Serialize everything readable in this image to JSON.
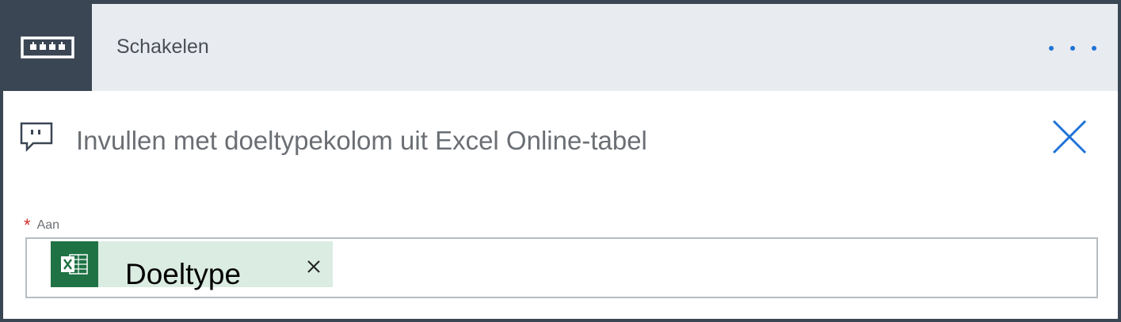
{
  "header": {
    "title": "Schakelen",
    "icon": "switch-icon",
    "more": "more-options-icon",
    "colors": {
      "bar": "#e8ebef",
      "icon_bg": "#3b4654",
      "accent": "#1f73d6"
    }
  },
  "action": {
    "title": "Invullen met doeltypekolom uit Excel Online-tabel",
    "icon": "comment-icon",
    "close": "close-icon"
  },
  "field": {
    "required_mark": "*",
    "label": "Aan",
    "token": {
      "label": "Doeltype",
      "icon": "excel-icon",
      "remove": "remove-icon",
      "colors": {
        "bg": "#dbece2",
        "icon_bg": "#1e7244"
      }
    }
  }
}
